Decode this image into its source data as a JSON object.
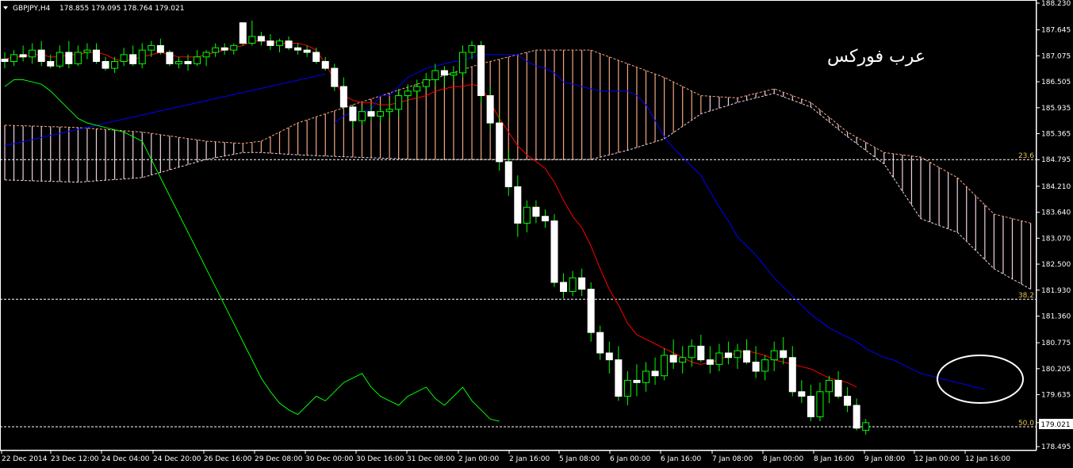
{
  "header": {
    "symbol": "GBPJPY,H4",
    "ohlc": "178.855 179.095 178.764 179.021"
  },
  "watermark": "عرب فوركس",
  "colors": {
    "background": "#000000",
    "bull": "#ffffff",
    "wick": "#00ff00",
    "tenkan": "#ff0000",
    "kijun": "#0000ff",
    "chikou": "#00ff00",
    "kumo_bull": "#f4a582",
    "kumo_bear": "#f0d0e0",
    "fib": "#ffffff",
    "fib_label": "#e8c84a",
    "highlight": "#ffffff"
  },
  "chart_data": {
    "type": "candlestick",
    "symbol": "GBPJPY",
    "timeframe": "H4",
    "ylim": [
      178.495,
      188.23
    ],
    "y_ticks": [
      "188.230",
      "187.645",
      "187.075",
      "186.505",
      "185.935",
      "185.365",
      "184.795",
      "184.210",
      "183.640",
      "183.070",
      "182.500",
      "181.930",
      "181.360",
      "180.775",
      "180.205",
      "179.635",
      "179.021",
      "178.495"
    ],
    "current_price": "179.021",
    "x_ticks": [
      "22 Dec 2014",
      "23 Dec 12:00",
      "24 Dec 04:00",
      "24 Dec 20:00",
      "26 Dec 16:00",
      "29 Dec 08:00",
      "30 Dec 00:00",
      "30 Dec 16:00",
      "31 Dec 08:00",
      "2 Jan 00:00",
      "2 Jan 16:00",
      "5 Jan 08:00",
      "6 Jan 00:00",
      "6 Jan 16:00",
      "7 Jan 08:00",
      "8 Jan 00:00",
      "8 Jan 16:00",
      "9 Jan 08:00",
      "12 Jan 00:00",
      "12 Jan 16:00"
    ],
    "fibonacci": [
      {
        "level": "23.6",
        "price": 184.795
      },
      {
        "level": "38.2",
        "price": 181.73
      },
      {
        "level": "50.0",
        "price": 178.93
      }
    ],
    "candles": [
      [
        187.0,
        187.15,
        186.8,
        186.95
      ],
      [
        186.95,
        187.2,
        186.85,
        187.1
      ],
      [
        187.1,
        187.3,
        186.95,
        187.05
      ],
      [
        187.05,
        187.35,
        186.9,
        187.2
      ],
      [
        187.2,
        187.4,
        186.85,
        186.95
      ],
      [
        186.95,
        187.1,
        186.8,
        186.85
      ],
      [
        186.85,
        187.3,
        186.8,
        187.15
      ],
      [
        187.15,
        187.4,
        186.8,
        186.9
      ],
      [
        186.9,
        187.3,
        186.85,
        187.15
      ],
      [
        187.15,
        187.35,
        187.0,
        187.2
      ],
      [
        187.2,
        187.35,
        186.9,
        186.95
      ],
      [
        186.95,
        187.05,
        186.75,
        186.8
      ],
      [
        186.8,
        187.05,
        186.7,
        186.95
      ],
      [
        186.95,
        187.25,
        186.85,
        187.1
      ],
      [
        187.1,
        187.3,
        186.85,
        186.9
      ],
      [
        186.9,
        187.35,
        186.8,
        187.2
      ],
      [
        187.2,
        187.4,
        187.05,
        187.3
      ],
      [
        187.3,
        187.45,
        187.1,
        187.15
      ],
      [
        187.15,
        187.2,
        186.85,
        186.9
      ],
      [
        186.9,
        187.05,
        186.8,
        186.95
      ],
      [
        186.95,
        187.1,
        186.75,
        186.9
      ],
      [
        186.9,
        187.2,
        186.85,
        187.05
      ],
      [
        187.05,
        187.2,
        186.85,
        187.15
      ],
      [
        187.15,
        187.35,
        187.05,
        187.25
      ],
      [
        187.25,
        187.35,
        187.1,
        187.2
      ],
      [
        187.2,
        187.35,
        187.1,
        187.3
      ],
      [
        187.8,
        187.8,
        187.3,
        187.35
      ],
      [
        187.35,
        187.85,
        187.3,
        187.5
      ],
      [
        187.5,
        187.6,
        187.3,
        187.4
      ],
      [
        187.4,
        187.55,
        187.2,
        187.3
      ],
      [
        187.3,
        187.45,
        187.15,
        187.4
      ],
      [
        187.4,
        187.5,
        187.2,
        187.25
      ],
      [
        187.25,
        187.35,
        187.1,
        187.2
      ],
      [
        187.2,
        187.3,
        187.05,
        187.15
      ],
      [
        187.15,
        187.25,
        186.9,
        186.95
      ],
      [
        186.95,
        187.05,
        186.75,
        186.8
      ],
      [
        186.8,
        186.9,
        186.3,
        186.4
      ],
      [
        186.4,
        186.6,
        185.9,
        185.95
      ],
      [
        185.95,
        186.0,
        185.5,
        185.65
      ],
      [
        185.65,
        185.95,
        185.55,
        185.85
      ],
      [
        185.85,
        186.0,
        185.65,
        185.75
      ],
      [
        185.75,
        186.0,
        185.6,
        185.85
      ],
      [
        185.85,
        186.1,
        185.7,
        185.9
      ],
      [
        185.9,
        186.35,
        185.75,
        186.2
      ],
      [
        186.2,
        186.45,
        186.05,
        186.3
      ],
      [
        186.3,
        186.55,
        186.15,
        186.4
      ],
      [
        186.4,
        186.7,
        186.3,
        186.55
      ],
      [
        186.55,
        186.9,
        186.4,
        186.75
      ],
      [
        186.75,
        186.85,
        186.4,
        186.65
      ],
      [
        186.65,
        186.85,
        186.5,
        186.7
      ],
      [
        186.7,
        187.3,
        186.6,
        187.15
      ],
      [
        187.15,
        187.4,
        187.0,
        187.3
      ],
      [
        187.3,
        187.4,
        186.05,
        186.2
      ],
      [
        186.2,
        186.4,
        185.45,
        185.6
      ],
      [
        185.6,
        185.8,
        184.55,
        184.75
      ],
      [
        184.75,
        185.0,
        184.0,
        184.2
      ],
      [
        184.2,
        184.45,
        183.1,
        183.4
      ],
      [
        183.4,
        183.9,
        183.2,
        183.75
      ],
      [
        183.75,
        183.9,
        183.4,
        183.55
      ],
      [
        183.55,
        183.7,
        183.3,
        183.45
      ],
      [
        183.45,
        183.6,
        182.0,
        182.1
      ],
      [
        182.1,
        182.3,
        181.75,
        181.9
      ],
      [
        181.9,
        182.35,
        181.8,
        182.2
      ],
      [
        182.2,
        182.4,
        181.8,
        181.95
      ],
      [
        181.95,
        182.1,
        180.8,
        181.0
      ],
      [
        181.0,
        181.15,
        180.4,
        180.55
      ],
      [
        180.55,
        180.8,
        180.1,
        180.4
      ],
      [
        180.4,
        180.7,
        179.5,
        179.6
      ],
      [
        179.6,
        180.15,
        179.4,
        179.95
      ],
      [
        179.95,
        180.3,
        179.6,
        179.9
      ],
      [
        179.9,
        180.35,
        179.7,
        180.15
      ],
      [
        180.15,
        180.45,
        179.85,
        180.05
      ],
      [
        180.05,
        180.65,
        179.95,
        180.5
      ],
      [
        180.5,
        180.85,
        180.2,
        180.35
      ],
      [
        180.35,
        180.7,
        180.1,
        180.45
      ],
      [
        180.45,
        180.85,
        180.25,
        180.7
      ],
      [
        180.7,
        180.95,
        180.35,
        180.4
      ],
      [
        180.4,
        180.7,
        180.1,
        180.3
      ],
      [
        180.3,
        180.75,
        180.15,
        180.55
      ],
      [
        180.55,
        180.8,
        180.3,
        180.45
      ],
      [
        180.45,
        180.75,
        180.2,
        180.6
      ],
      [
        180.6,
        180.85,
        180.3,
        180.35
      ],
      [
        180.35,
        180.7,
        180.0,
        180.15
      ],
      [
        180.15,
        180.5,
        179.95,
        180.4
      ],
      [
        180.4,
        180.8,
        180.15,
        180.6
      ],
      [
        180.6,
        180.9,
        180.3,
        180.45
      ],
      [
        180.45,
        180.7,
        179.6,
        179.7
      ],
      [
        179.7,
        179.95,
        179.45,
        179.6
      ],
      [
        179.6,
        179.85,
        179.05,
        179.15
      ],
      [
        179.15,
        179.9,
        179.05,
        179.7
      ],
      [
        179.7,
        180.05,
        179.45,
        179.95
      ],
      [
        179.95,
        180.15,
        179.55,
        179.6
      ],
      [
        179.6,
        179.8,
        179.25,
        179.4
      ],
      [
        179.4,
        179.55,
        178.85,
        178.9
      ],
      [
        178.85,
        179.1,
        178.76,
        179.02
      ]
    ],
    "tenkan": [
      187.0,
      187.05,
      187.05,
      187.1,
      187.1,
      187.05,
      187.05,
      187.1,
      187.1,
      187.15,
      187.15,
      187.1,
      187.0,
      186.95,
      187.0,
      187.05,
      187.1,
      187.15,
      187.1,
      187.05,
      187.05,
      187.05,
      187.1,
      187.15,
      187.2,
      187.25,
      187.3,
      187.4,
      187.4,
      187.4,
      187.35,
      187.35,
      187.35,
      187.3,
      187.2,
      186.9,
      186.55,
      186.2,
      186.1,
      186.05,
      186.05,
      186.0,
      186.0,
      186.05,
      186.1,
      186.15,
      186.2,
      186.3,
      186.35,
      186.4,
      186.4,
      186.45,
      186.4,
      186.05,
      185.7,
      185.4,
      185.1,
      184.9,
      184.75,
      184.6,
      184.3,
      183.9,
      183.55,
      183.3,
      182.9,
      182.4,
      181.95,
      181.6,
      181.2,
      180.95,
      180.85,
      180.75,
      180.65,
      180.55,
      180.45,
      180.35,
      180.3,
      180.35,
      180.4,
      180.5,
      180.55,
      180.6,
      180.55,
      180.5,
      180.4,
      180.35,
      180.3,
      180.25,
      180.2,
      180.1,
      180.0,
      179.95,
      179.9,
      179.8
    ],
    "kijun": [
      185.6,
      185.75,
      185.85,
      185.85,
      185.9,
      186.2,
      186.2,
      186.4,
      186.6,
      186.7,
      186.8,
      186.85,
      186.9,
      186.95,
      186.95,
      187.05,
      187.1,
      187.1,
      187.1,
      187.1,
      187.1,
      186.95,
      186.85,
      186.8,
      186.7,
      186.5,
      186.45,
      186.4,
      186.35,
      186.3,
      186.3,
      186.3,
      186.3,
      186.2,
      186.0,
      185.65,
      185.3,
      185.05,
      184.85,
      184.65,
      184.45,
      184.1,
      183.75,
      183.45,
      183.1,
      182.9,
      182.7,
      182.45,
      182.2,
      182.0,
      181.8,
      181.6,
      181.4,
      181.25,
      181.1,
      181.0,
      180.9,
      180.8,
      180.65,
      180.55,
      180.45,
      180.4,
      180.3,
      180.2,
      180.1,
      180.05,
      180.0,
      179.95,
      179.9,
      179.85,
      179.8,
      179.75
    ],
    "kijun_start": 0,
    "chikou": [
      186.4,
      186.55,
      186.55,
      186.5,
      186.45,
      186.3,
      186.1,
      185.9,
      185.7,
      185.6,
      185.55,
      185.5,
      185.45,
      185.4,
      185.3,
      185.2,
      184.8,
      184.4,
      184.0,
      183.6,
      183.2,
      182.8,
      182.4,
      182.0,
      181.6,
      181.2,
      180.8,
      180.4,
      180.0,
      179.7,
      179.45,
      179.3,
      179.2,
      179.4,
      179.6,
      179.5,
      179.7,
      179.9,
      180.0,
      180.1,
      179.8,
      179.6,
      179.5,
      179.4,
      179.6,
      179.7,
      179.8,
      179.55,
      179.4,
      179.6,
      179.8,
      179.5,
      179.3,
      179.1,
      179.05
    ],
    "kumo": [
      {
        "i": 0,
        "a": 185.55,
        "b": 184.35
      },
      {
        "i": 8,
        "a": 185.5,
        "b": 184.3
      },
      {
        "i": 15,
        "a": 185.4,
        "b": 184.4
      },
      {
        "i": 22,
        "a": 185.2,
        "b": 184.8
      },
      {
        "i": 26,
        "a": 185.15,
        "b": 184.95
      },
      {
        "i": 28,
        "a": 185.2,
        "b": 184.95
      },
      {
        "i": 32,
        "a": 185.6,
        "b": 184.9
      },
      {
        "i": 38,
        "a": 186.0,
        "b": 184.85
      },
      {
        "i": 45,
        "a": 186.45,
        "b": 184.8
      },
      {
        "i": 52,
        "a": 186.9,
        "b": 184.8
      },
      {
        "i": 58,
        "a": 187.2,
        "b": 184.8
      },
      {
        "i": 64,
        "a": 187.2,
        "b": 184.8
      },
      {
        "i": 68,
        "a": 186.9,
        "b": 185.0
      },
      {
        "i": 72,
        "a": 186.6,
        "b": 185.25
      },
      {
        "i": 76,
        "a": 186.2,
        "b": 185.8
      },
      {
        "i": 80,
        "a": 186.15,
        "b": 186.05
      },
      {
        "i": 84,
        "a": 186.35,
        "b": 186.25
      },
      {
        "i": 88,
        "a": 186.05,
        "b": 185.95
      },
      {
        "i": 92,
        "a": 185.4,
        "b": 185.3
      },
      {
        "i": 96,
        "a": 184.95,
        "b": 184.7
      },
      {
        "i": 100,
        "a": 184.85,
        "b": 183.5
      },
      {
        "i": 104,
        "a": 184.4,
        "b": 183.2
      },
      {
        "i": 108,
        "a": 183.6,
        "b": 182.4
      },
      {
        "i": 112,
        "a": 183.4,
        "b": 181.95
      }
    ]
  }
}
